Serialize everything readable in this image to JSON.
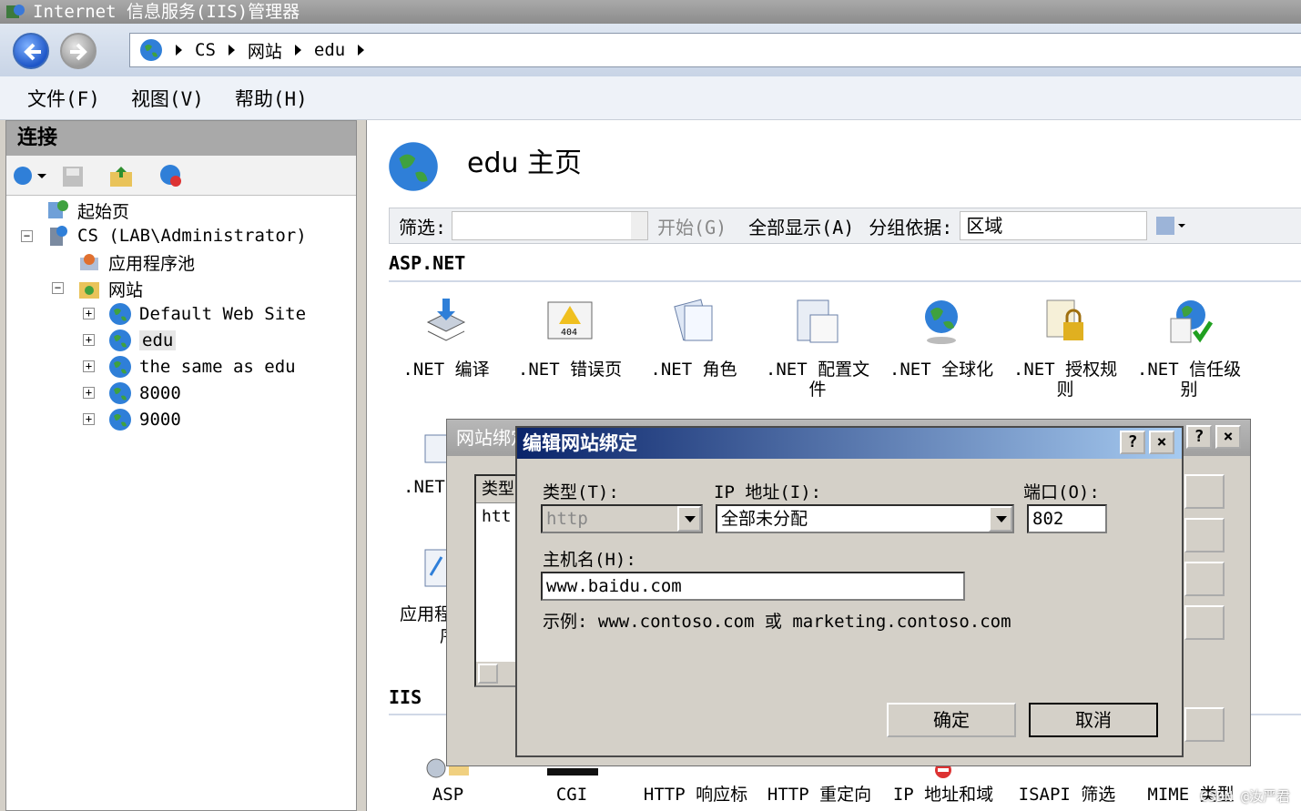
{
  "window": {
    "title": "Internet 信息服务(IIS)管理器"
  },
  "address": {
    "crumbs": [
      "CS",
      "网站",
      "edu"
    ]
  },
  "menu": {
    "items": [
      "文件(F)",
      "视图(V)",
      "帮助(H)"
    ]
  },
  "connections": {
    "header": "连接",
    "tree": {
      "start": "起始页",
      "server": "CS (LAB\\Administrator)",
      "apppools": "应用程序池",
      "sites": "网站",
      "site1": "Default Web Site",
      "site2": "edu",
      "site3": "the same as edu",
      "site4": "8000",
      "site5": "9000"
    }
  },
  "main": {
    "title": "edu 主页",
    "filter": {
      "label": "筛选:",
      "start": "开始(G)",
      "showall": "全部显示(A)",
      "groupby": "分组依据:",
      "groupvalue": "区域"
    },
    "section_aspnet": "ASP.NET",
    "section_iis": "IIS",
    "aspnet_features": [
      {
        "line1": ".NET 编译",
        "line2": ""
      },
      {
        "line1": ".NET 错误页",
        "line2": ""
      },
      {
        "line1": ".NET 角色",
        "line2": ""
      },
      {
        "line1": ".NET 配置文",
        "line2": "件"
      },
      {
        "line1": ".NET 全球化",
        "line2": ""
      },
      {
        "line1": ".NET 授权规",
        "line2": "则"
      },
      {
        "line1": ".NET 信任级",
        "line2": "别"
      }
    ],
    "partial_row2": {
      "net": ".NET",
      "app": "应用程",
      "app2": "序"
    },
    "iis_features": [
      "ASP",
      "CGI",
      "HTTP 响应标",
      "HTTP 重定向",
      "IP 地址和域",
      "ISAPI 筛选",
      "MIME 类型"
    ]
  },
  "back_dialog": {
    "title": "网站绑定",
    "col_type": "类型",
    "row_type": "htt"
  },
  "dialog": {
    "title": "编辑网站绑定",
    "type_label": "类型(T):",
    "type_value": "http",
    "ip_label": "IP 地址(I):",
    "ip_value": "全部未分配",
    "port_label": "端口(O):",
    "port_value": "802",
    "host_label": "主机名(H):",
    "host_value": "www.baidu.com",
    "example": "示例: www.contoso.com 或 marketing.contoso.com",
    "ok": "确定",
    "cancel": "取消",
    "help": "?",
    "close": "×"
  },
  "watermark": "CSDN @汝严君"
}
